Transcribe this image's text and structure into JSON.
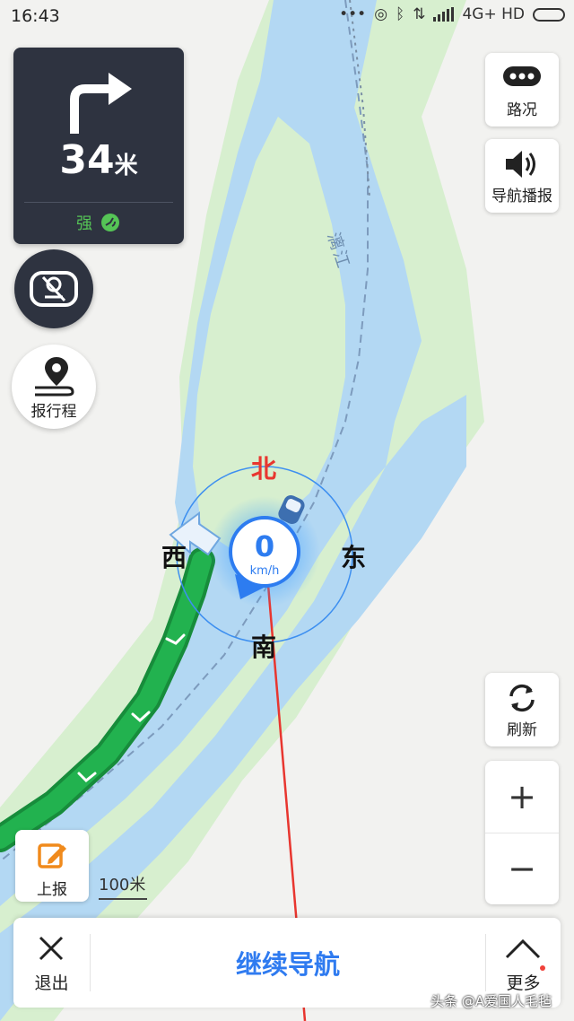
{
  "status_bar": {
    "time": "16:43",
    "network": "4G+ HD"
  },
  "guidance": {
    "turn_icon": "turn-right-arrow-icon",
    "distance_value": "34",
    "distance_unit": "米",
    "gps_signal_label": "强"
  },
  "left_buttons": {
    "voice_toggle_icon": "voice-mute-icon",
    "share_trip_label": "报行程"
  },
  "right_buttons": {
    "road_condition_label": "路况",
    "broadcast_label": "导航播报",
    "refresh_label": "刷新",
    "zoom_in_symbol": "+",
    "zoom_out_symbol": "−"
  },
  "map": {
    "river_name": "漓江",
    "compass": {
      "north": "北",
      "south": "南",
      "east": "东",
      "west": "西"
    },
    "speed_value": "0",
    "speed_unit": "km/h",
    "scale_label": "100米",
    "colors": {
      "water": "#b3d8f3",
      "greenland": "#d7efcf",
      "route": "#1fac4b",
      "accent_blue": "#2d7cf0",
      "north_red": "#e8362f"
    }
  },
  "report": {
    "label": "上报"
  },
  "bottom_bar": {
    "exit_label": "退出",
    "continue_label": "继续导航",
    "more_label": "更多"
  },
  "watermark": "头条 @A爱国人毛毡"
}
